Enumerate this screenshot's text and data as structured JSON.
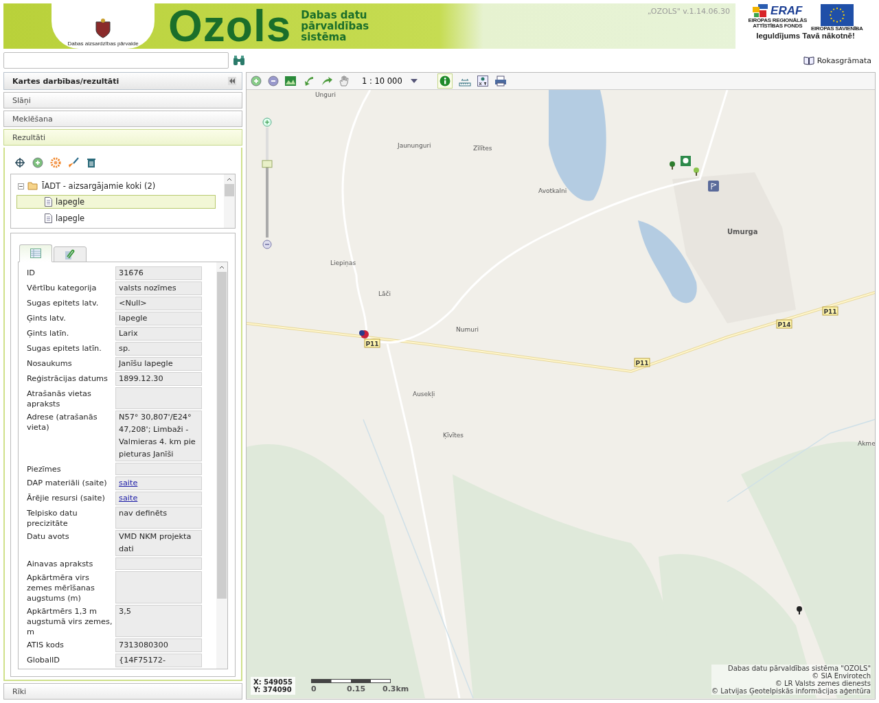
{
  "header": {
    "agency": "Dabas aizsardzības pārvalde",
    "logo": "Ozols",
    "tagline": [
      "Dabas datu",
      "pārvaldības",
      "sistēma"
    ],
    "version": "„OZOLS\" v.1.14.06.30",
    "eraf": {
      "name": "ERAF",
      "fund": [
        "EIROPAS REGIONĀLĀS",
        "ATTĪSTĪBAS FONDS"
      ],
      "eu": "EIROPAS SAVIENĪBA",
      "slogan": "Ieguldījums Tavā nākotnē!"
    }
  },
  "manual_link": "Rokasgrāmata",
  "panel": {
    "title": "Kartes darbības/rezultāti",
    "sections": [
      {
        "label": "Slāņi",
        "expanded": false
      },
      {
        "label": "Meklēšana",
        "expanded": false
      },
      {
        "label": "Rezultāti",
        "expanded": true
      }
    ],
    "tree": {
      "label": "ĪADT - aizsargājamie koki (2)",
      "expanded": true,
      "children": [
        {
          "label": "lapegle",
          "selected": true
        },
        {
          "label": "lapegle",
          "selected": false
        }
      ]
    },
    "detail_tabs": [
      {
        "kind": "table",
        "selected": true
      },
      {
        "kind": "attachments",
        "selected": false
      }
    ],
    "fields": [
      {
        "label": "ID",
        "value": "31676",
        "kind": "text"
      },
      {
        "label": "Vērtību kategorija",
        "value": "valsts nozīmes",
        "kind": "text"
      },
      {
        "label": "Sugas epitets latv.",
        "value": "<Null>",
        "kind": "text"
      },
      {
        "label": "Ģints latv.",
        "value": "lapegle",
        "kind": "text"
      },
      {
        "label": "Ģints latīn.",
        "value": "Larix",
        "kind": "text"
      },
      {
        "label": "Sugas epitets latīn.",
        "value": "sp.",
        "kind": "text"
      },
      {
        "label": "Nosaukums",
        "value": "Janīšu lapegle",
        "kind": "text"
      },
      {
        "label": "Reģistrācijas datums",
        "value": "1899.12.30",
        "kind": "text"
      },
      {
        "label": "Atrašanās vietas apraksts"
      },
      {
        "label": "Adrese (atrašanās vieta)",
        "value": "N57° 30,807'/E24° 47,208'; Limbaži - Valmieras 4. km pie pieturas Janīši",
        "kind": "text"
      },
      {
        "label": "Piezīmes"
      },
      {
        "label": "DAP materiāli (saite)",
        "value": "saite",
        "kind": "link"
      },
      {
        "label": "Ārējie resursi (saite)",
        "value": "saite",
        "kind": "link"
      },
      {
        "label": "Telpisko datu precizitāte",
        "value": "nav definēts",
        "kind": "text"
      },
      {
        "label": "Datu avots",
        "value": "VMD NKM projekta dati",
        "kind": "text"
      },
      {
        "label": "Ainavas apraksts"
      },
      {
        "label": "Apkārtmēra virs zemes mērīšanas augstums (m)"
      },
      {
        "label": "Apkārtmērs 1,3 m augstumā virs zemes, m",
        "value": "3,5",
        "kind": "text"
      },
      {
        "label": "ATIS kods",
        "value": "7313080300",
        "kind": "text"
      },
      {
        "label": "GlobalID",
        "value": "{14F75172-",
        "kind": "text"
      }
    ],
    "tools_section": {
      "label": "Rīki",
      "expanded": false
    }
  },
  "map": {
    "scale": "1 : 10 000",
    "zoom": {
      "level": 0.67
    },
    "places": [
      {
        "name": "Unguri",
        "kind": "place"
      },
      {
        "name": "Jaununguri",
        "kind": "place"
      },
      {
        "name": "Zīlītes",
        "kind": "place"
      },
      {
        "name": "Avotkalni",
        "kind": "place"
      },
      {
        "name": "Umurga",
        "kind": "town"
      },
      {
        "name": "Liepiņas",
        "kind": "place"
      },
      {
        "name": "Lāči",
        "kind": "place"
      },
      {
        "name": "Numuri",
        "kind": "place"
      },
      {
        "name": "Ausekļi",
        "kind": "place"
      },
      {
        "name": "Ķīvītes",
        "kind": "place"
      },
      {
        "name": "Akme",
        "kind": "place"
      },
      {
        "name": "P11",
        "kind": "road"
      },
      {
        "name": "P14",
        "kind": "road"
      },
      {
        "name": "P11",
        "kind": "road"
      },
      {
        "name": "P11",
        "kind": "road"
      }
    ],
    "coords": {
      "x": "X: 549055",
      "y": "Y: 374090"
    },
    "scale_bar": [
      "0",
      "0.15",
      "0.3km"
    ],
    "attribution": [
      "Dabas datu pārvaldības sistēma \"OZOLS\"",
      "© SIA Envirotech",
      "© LR Valsts zemes dienests",
      "© Latvijas Ģeotelpiskās informācijas aģentūra"
    ]
  }
}
